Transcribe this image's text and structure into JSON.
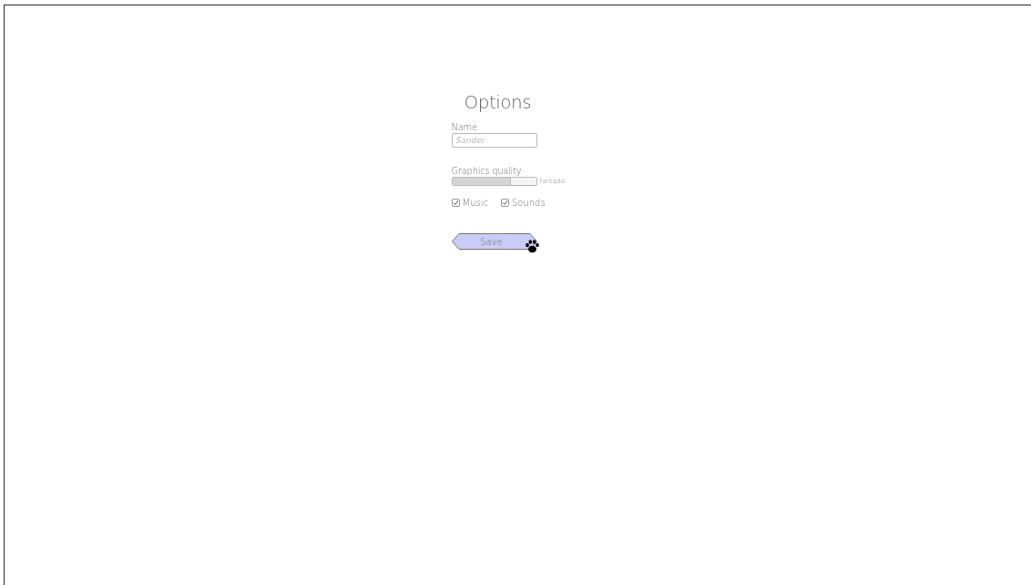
{
  "title": "Options",
  "name_field": {
    "label": "Name",
    "placeholder": "Sander"
  },
  "graphics_quality": {
    "label": "Graphics quality",
    "level": 0.7,
    "reading": "Fantastic"
  },
  "checkboxes": [
    {
      "label": "Music",
      "checked": true
    },
    {
      "label": "Sounds",
      "checked": true
    }
  ],
  "save_button": {
    "label": "Save"
  }
}
